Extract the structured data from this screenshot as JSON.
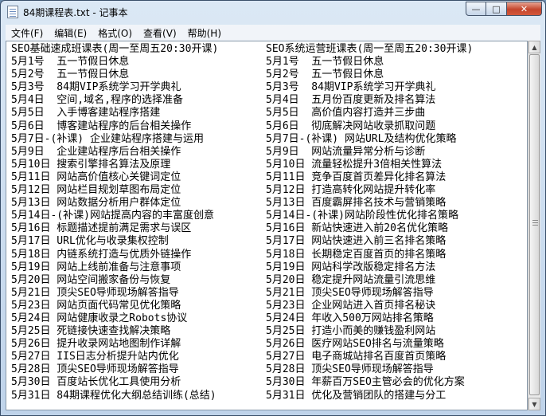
{
  "window": {
    "title": "84期课程表.txt - 记事本",
    "icons": {
      "app": "notepad-icon",
      "minimize": "minimize-icon",
      "maximize": "maximize-icon",
      "close": "close-icon"
    }
  },
  "menu": [
    "文件(F)",
    "编辑(E)",
    "格式(O)",
    "查看(V)",
    "帮助(H)"
  ],
  "editor": {
    "left": [
      "SEO基础速成班课表(周一至周五20:30开课)",
      "5月1号  五一节假日休息",
      "5月2号  五一节假日休息",
      "5月3号  84期VIP系统学习开学典礼",
      "5月4日  空间,域名,程序的选择准备",
      "5月5日  入手博客建站程序搭建",
      "5月6日  博客建站程序的后台相关操作",
      "5月7日-(补课) 企业建站程序搭建与运用",
      "5月9日  企业建站程序后台相关操作",
      "5月10日 搜索引擎排名算法及原理",
      "5月11日 网站高价值核心关键词定位",
      "5月12日 网站栏目规划草图布局定位",
      "5月13日 网站数据分析用户群体定位",
      "5月14日-(补课)网站提高内容的丰富度创意",
      "5月16日 标题描述提前满足需求与误区",
      "5月17日 URL优化与收录集权控制",
      "5月18日 内链系统打造与优质外链操作",
      "5月19日 网站上线前准备与注意事项",
      "5月20日 网站空间搬家备份与恢复",
      "5月21日 顶尖SEO导师现场解答指导",
      "5月23日 网站页面代码常见优化策略",
      "5月24日 网站健康收录之Robots协议",
      "5月25日 死链接快速查找解决策略",
      "5月26日 提升收录网站地图制作详解",
      "5月27日 IIS日志分析提升站内优化",
      "5月28日 顶尖SEO导师现场解答指导",
      "5月30日 百度站长优化工具使用分析",
      "5月31日 84期课程优化大纲总结训练(总结)"
    ],
    "right": [
      "SEO系统运营班课表(周一至周五20:30开课)",
      "5月1号  五一节假日休息",
      "5月2号  五一节假日休息",
      "5月3号  84期VIP系统学习开学典礼",
      "5月4日  五月份百度更新及排名算法",
      "5月5日  高价值内容打造并三步曲",
      "5月6日  彻底解决网站收录抓取问题",
      "5月7日-(补课) 网站URL及结构优化策略",
      "5月9日  网站流量异常分析与诊断",
      "5月10日 流量轻松提升3倍相关性算法",
      "5月11日 竞争百度首页差异化排名算法",
      "5月12日 打造高转化网站提升转化率",
      "5月13日 百度霸屏排名技术与营销策略",
      "5月14日-(补课)网站阶段性优化排名策略",
      "5月16日 新站快速进入前20名优化策略",
      "5月17日 网站快速进入前三名排名策略",
      "5月18日 长期稳定百度首页的排名策略",
      "5月19日 网站科学改版稳定排名方法",
      "5月20日 稳定提升网站流量引流思维",
      "5月21日 顶尖SEO导师现场解答指导",
      "5月23日 企业网站进入首页排名秘诀",
      "5月24日 年收入500万网站排名策略",
      "5月25日 打造小而美的赚钱盈利网站",
      "5月26日 医疗网站SEO排名与流量策略",
      "5月27日 电子商城站排名百度首页策略",
      "5月28日 顶尖SEO导师现场解答指导",
      "5月30日 年薪百万SEO主管必会的优化方案",
      "5月31日 优化及营销团队的搭建与分工"
    ]
  }
}
